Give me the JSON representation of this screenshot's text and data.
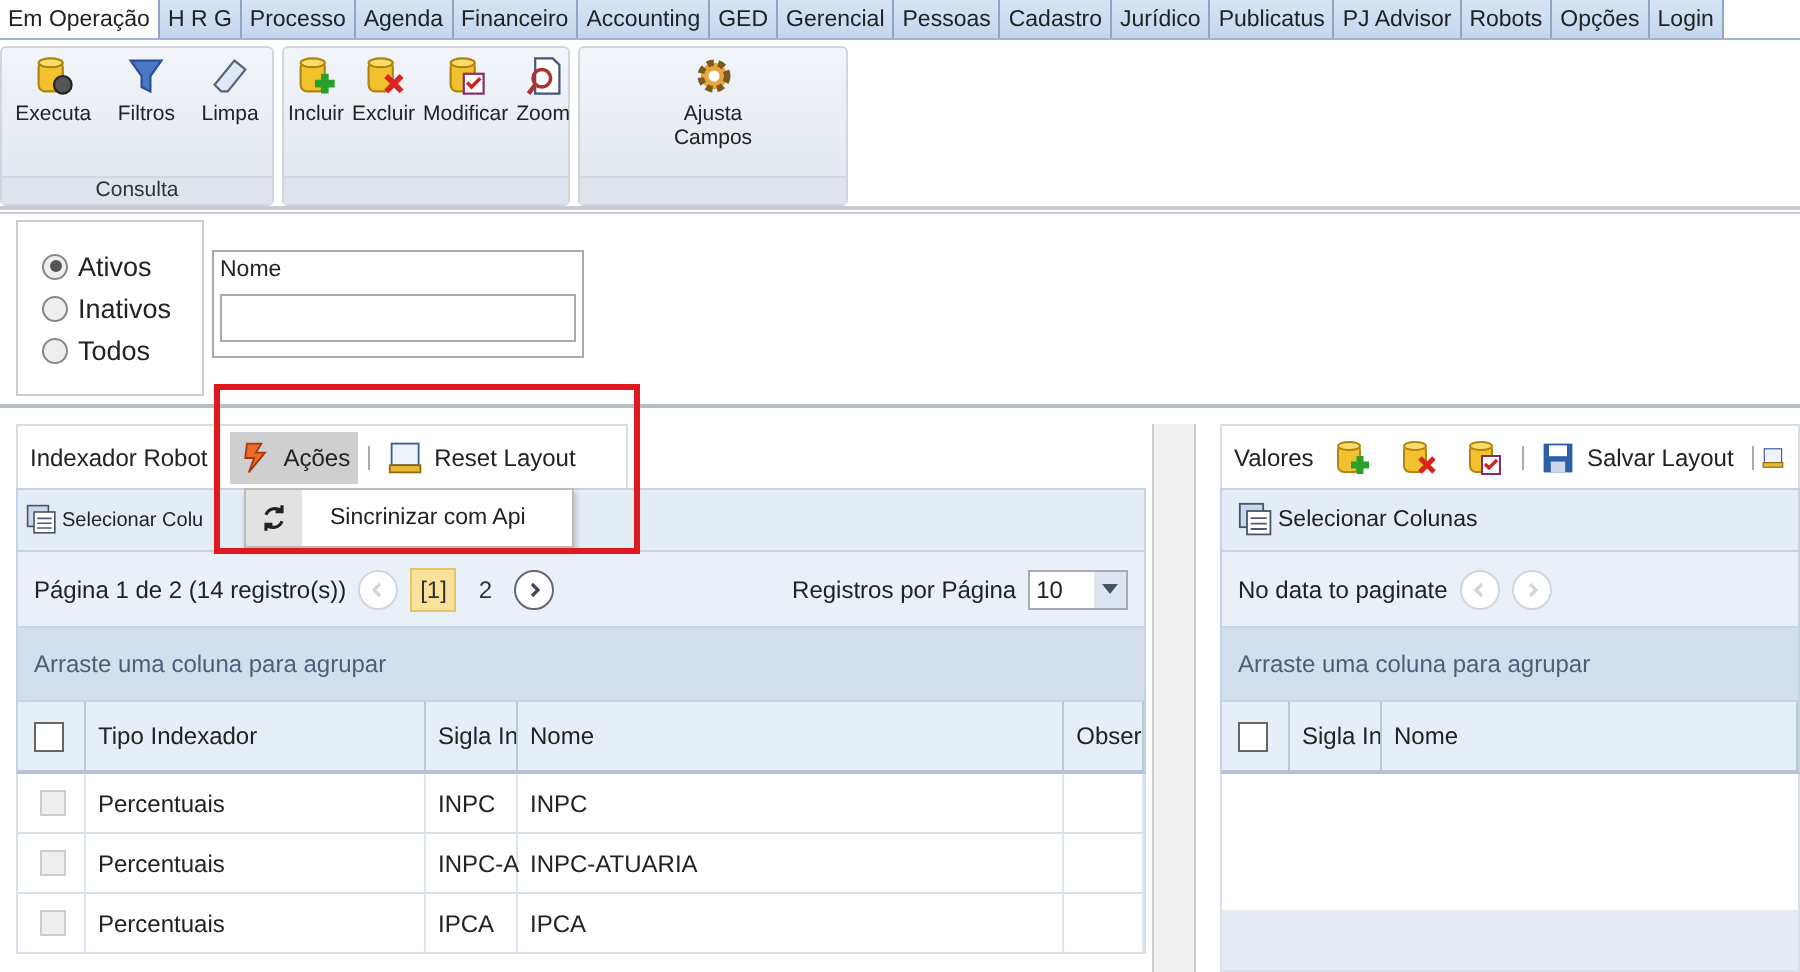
{
  "menu_tabs": [
    {
      "label": "Em Operação",
      "selected": true
    },
    {
      "label": "H R G",
      "selected": false
    },
    {
      "label": "Processo",
      "selected": false
    },
    {
      "label": "Agenda",
      "selected": false
    },
    {
      "label": "Financeiro",
      "selected": false
    },
    {
      "label": "Accounting",
      "selected": false
    },
    {
      "label": "GED",
      "selected": false
    },
    {
      "label": "Gerencial",
      "selected": false
    },
    {
      "label": "Pessoas",
      "selected": false
    },
    {
      "label": "Cadastro",
      "selected": false
    },
    {
      "label": "Jurídico",
      "selected": false
    },
    {
      "label": "Publicatus",
      "selected": false
    },
    {
      "label": "PJ Advisor",
      "selected": false
    },
    {
      "label": "Robots",
      "selected": false
    },
    {
      "label": "Opções",
      "selected": false
    },
    {
      "label": "Login",
      "selected": false
    }
  ],
  "ribbon": {
    "groups": [
      {
        "label": "Consulta",
        "buttons": [
          {
            "label": "Executa",
            "kind": "run"
          },
          {
            "label": "Filtros",
            "kind": "filter"
          },
          {
            "label": "Limpa",
            "kind": "eraser"
          }
        ]
      },
      {
        "buttons": [
          {
            "label": "Incluir",
            "kind": "add"
          },
          {
            "label": "Excluir",
            "kind": "delete"
          },
          {
            "label": "Modificar",
            "kind": "edit"
          },
          {
            "label": "Zoom",
            "kind": "zoom"
          }
        ]
      },
      {
        "buttons": [
          {
            "label": "Ajusta Campos",
            "kind": "adjust"
          }
        ]
      }
    ]
  },
  "status_filter": {
    "options": [
      {
        "label": "Ativos",
        "selected": true
      },
      {
        "label": "Inativos",
        "selected": false
      },
      {
        "label": "Todos",
        "selected": false
      }
    ]
  },
  "name_filter": {
    "label": "Nome"
  },
  "left_panel": {
    "toolbar": [
      {
        "kind": "title",
        "label": "Indexador Robot"
      },
      {
        "kind": "menu",
        "label": "Ações",
        "expanded": true
      },
      {
        "kind": "layout",
        "label": "Reset Layout"
      }
    ],
    "menu_items": [
      {
        "label": "Sincrinizar com Api"
      }
    ],
    "column_chooser": "Selecionar Colu",
    "pager": {
      "summary": "Página 1 de 2 (14 registro(s))",
      "prev_disabled": true,
      "next_disabled": false,
      "pages": [
        {
          "label": "[1]",
          "selected": true
        },
        {
          "label": "2",
          "selected": false
        }
      ],
      "page_size_label": "Registros por Página",
      "page_size": "10"
    },
    "group_hint": "Arraste uma coluna para agrupar",
    "select_all_checked": false,
    "columns": [
      "Tipo Indexador",
      "Sigla In",
      "Nome",
      "Obser"
    ],
    "rows": [
      {
        "checked": false,
        "cells": [
          "Percentuais",
          "INPC",
          "INPC",
          ""
        ]
      },
      {
        "checked": false,
        "cells": [
          "Percentuais",
          "INPC-A",
          "INPC-ATUARIA",
          ""
        ]
      },
      {
        "checked": false,
        "cells": [
          "Percentuais",
          "IPCA",
          "IPCA",
          ""
        ]
      }
    ]
  },
  "right_panel": {
    "toolbar": [
      {
        "kind": "title",
        "label": "Valores"
      },
      {
        "kind": "add"
      },
      {
        "kind": "delete"
      },
      {
        "kind": "edit"
      },
      {
        "kind": "save",
        "label": "Salvar Layout"
      },
      {
        "kind": "layout"
      }
    ],
    "column_chooser": "Selecionar Colunas",
    "pager": {
      "summary": "No data to paginate",
      "prev_disabled": true,
      "next_disabled": true
    },
    "group_hint": "Arraste uma coluna para agrupar",
    "select_all_checked": false,
    "columns": [
      "Sigla In",
      "Nome"
    ]
  }
}
